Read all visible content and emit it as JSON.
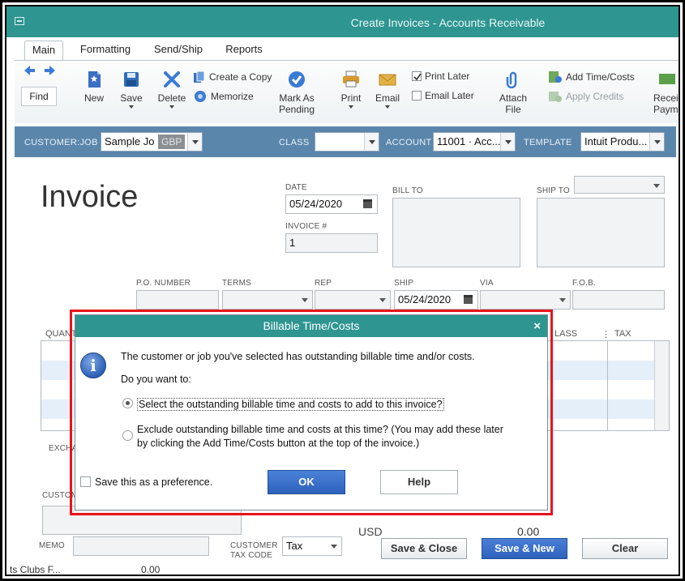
{
  "window": {
    "title": "Create Invoices - Accounts Receivable"
  },
  "ribbon": {
    "tabs": [
      "Main",
      "Formatting",
      "Send/Ship",
      "Reports"
    ],
    "find": "Find",
    "new": "New",
    "save": "Save",
    "delete": "Delete",
    "create_copy": "Create a Copy",
    "memorize": "Memorize",
    "mark_as_pending": "Mark As\nPending",
    "print": "Print",
    "email": "Email",
    "print_later": "Print Later",
    "email_later": "Email Later",
    "attach_file": "Attach\nFile",
    "add_time_costs": "Add Time/Costs",
    "apply_credits": "Apply Credits",
    "receive_payments": "Recei\nPayme"
  },
  "customer_bar": {
    "customer_job_label": "CUSTOMER:JOB",
    "customer_job_value": "Sample Jo",
    "currency_badge": "GBP",
    "class_label": "CLASS",
    "class_value": "",
    "account_label": "ACCOUNT",
    "account_value": "11001 · Acc...",
    "template_label": "TEMPLATE",
    "template_value": "Intuit Produ..."
  },
  "invoice": {
    "heading": "Invoice",
    "date_label": "DATE",
    "date_value": "05/24/2020",
    "invoice_no_label": "INVOICE #",
    "invoice_no_value": "1",
    "bill_to_label": "BILL TO",
    "ship_to_label": "SHIP TO",
    "po_label": "P.O. NUMBER",
    "terms_label": "TERMS",
    "rep_label": "REP",
    "ship_label": "SHIP",
    "ship_value": "05/24/2020",
    "via_label": "VIA",
    "fob_label": "F.O.B.",
    "col_quantity": "QUANT",
    "col_class": "LASS",
    "col_tax": "TAX",
    "exchange_label": "EXCHA",
    "customer_msg_label": "CUSTOM",
    "memo_label": "MEMO",
    "customer_tax_code_label": "CUSTOMER\nTAX CODE",
    "tax_code_value": "Tax",
    "currency": "USD",
    "total": "0.00",
    "bottom_strip_left": "ts Clubs F...",
    "bottom_strip_value": "0.00"
  },
  "buttons": {
    "save_close": "Save & Close",
    "save_new": "Save & New",
    "clear": "Clear"
  },
  "dialog": {
    "title": "Billable Time/Costs",
    "close": "×",
    "message": "The customer or job you've selected has outstanding billable time and/or costs.",
    "question": "Do you want to:",
    "option_select": "Select the outstanding billable time and costs to add to this invoice?",
    "option_exclude_line1": "Exclude outstanding billable time and costs at this time? (You may add these later",
    "option_exclude_line2": "by clicking the Add Time/Costs button at the top of the invoice.)",
    "save_preference": "Save this as a preference.",
    "ok": "OK",
    "help": "Help"
  },
  "icons": {
    "find_back": "arrow-left-icon",
    "find_forward": "arrow-right-icon",
    "new": "new-document-icon",
    "save": "floppy-disk-icon",
    "delete": "x-delete-icon",
    "create_copy": "copy-icon",
    "memorize": "memorize-icon",
    "mark_pending": "check-circle-icon",
    "print": "printer-icon",
    "email": "envelope-icon",
    "attach": "paperclip-icon",
    "add_time_costs": "add-time-icon",
    "apply_credits": "credits-icon",
    "info": "info-icon"
  },
  "colors": {
    "titlebar": "#2e9591",
    "customer_bar": "#5b86ab",
    "dialog_highlight": "#e8141a",
    "primary_button": "#2f62bd"
  }
}
